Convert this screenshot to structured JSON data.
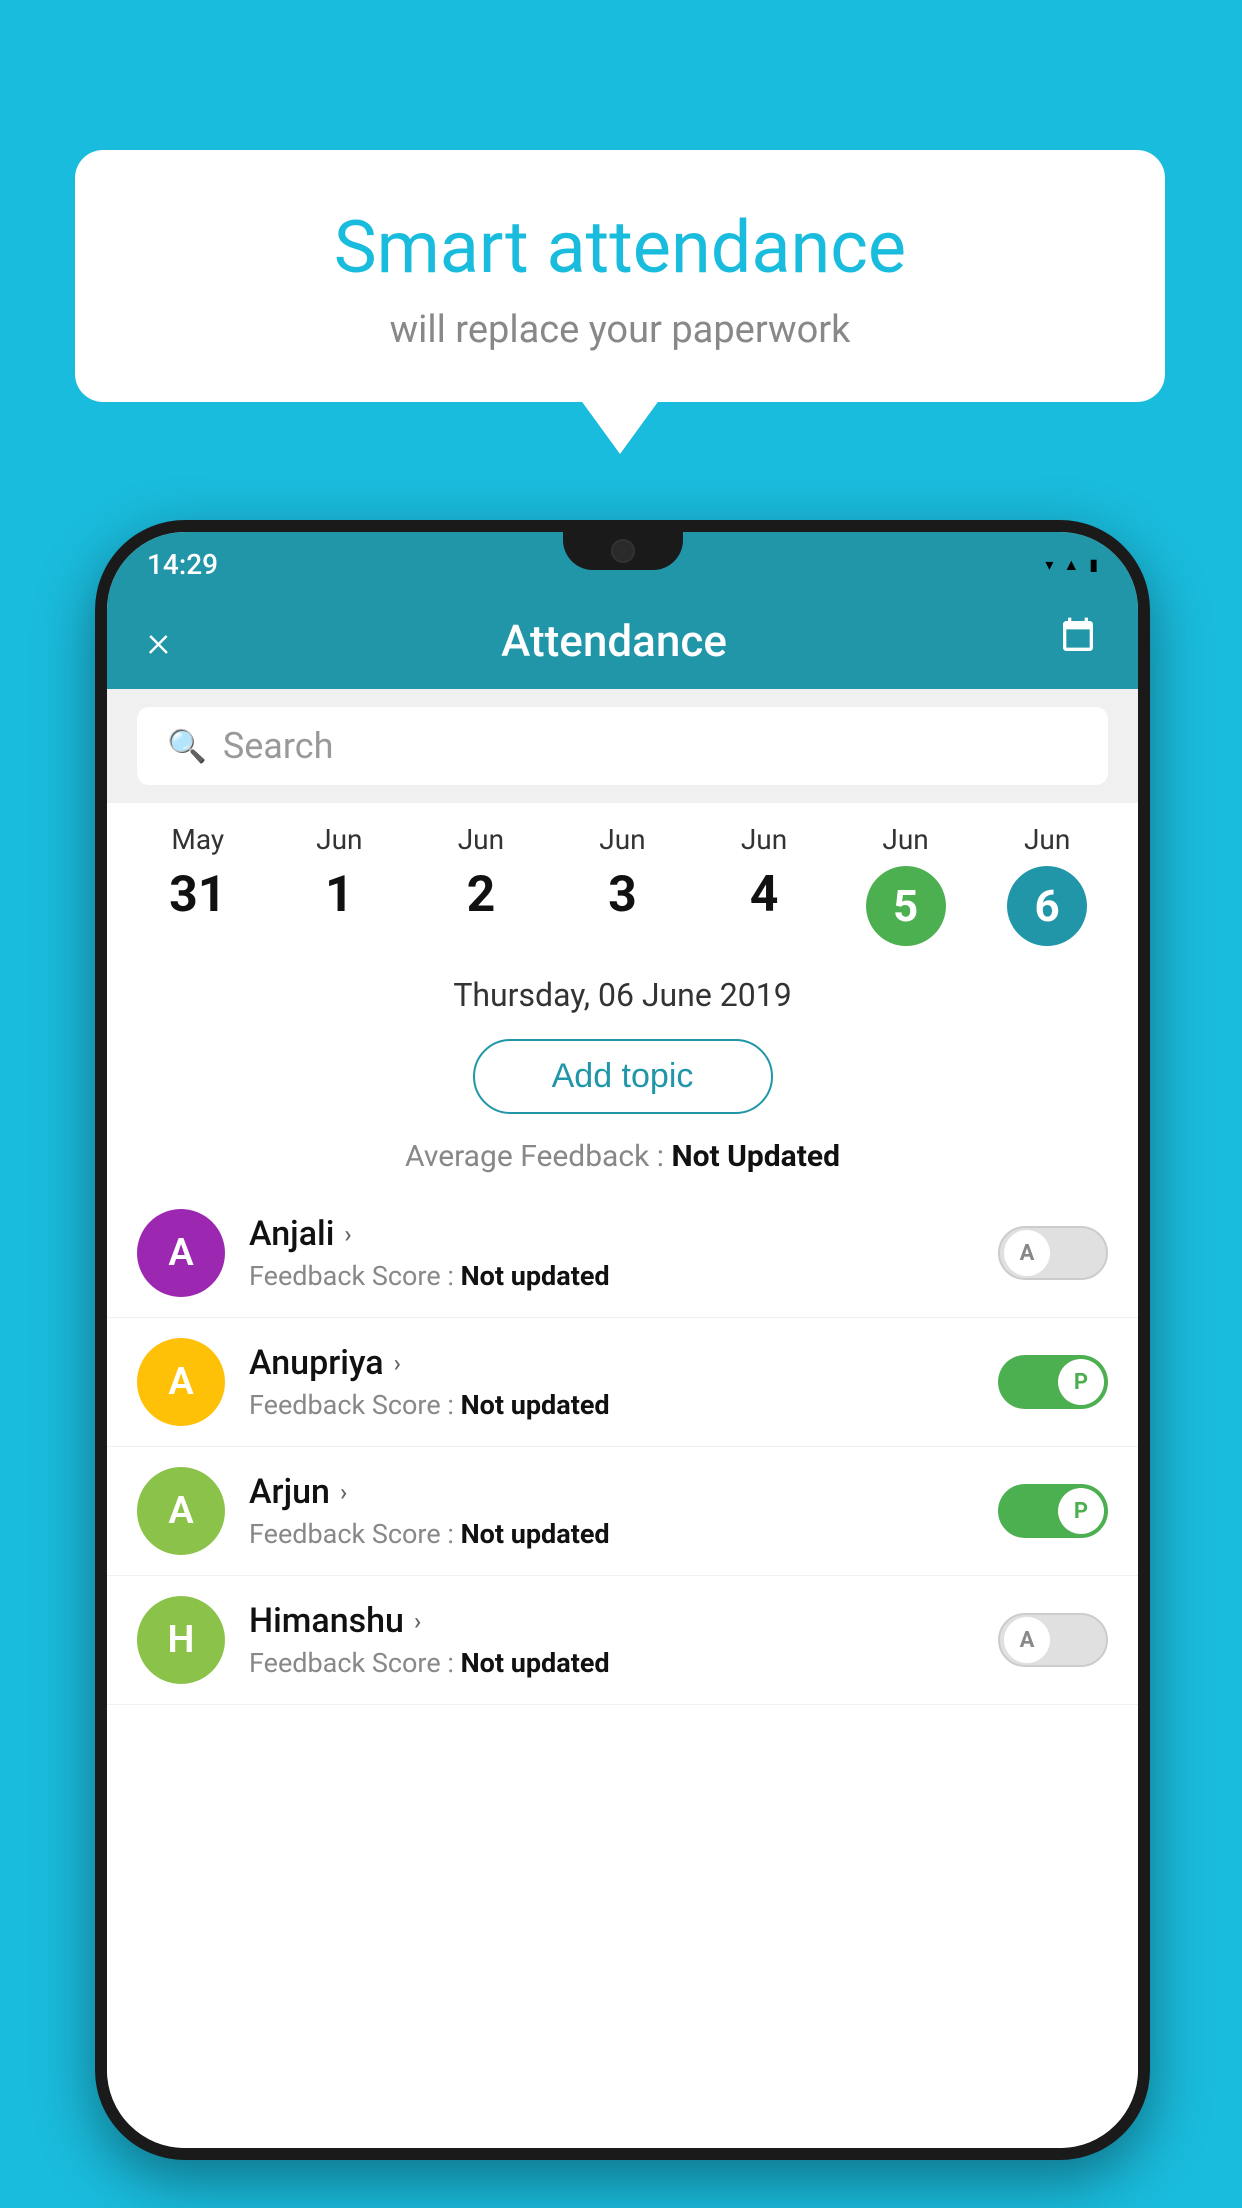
{
  "background_color": "#1ABCDD",
  "speech_bubble": {
    "title": "Smart attendance",
    "subtitle": "will replace your paperwork"
  },
  "status_bar": {
    "time": "14:29",
    "icons": [
      "wifi",
      "signal",
      "battery"
    ]
  },
  "app_bar": {
    "title": "Attendance",
    "close_label": "×",
    "calendar_icon": "📅"
  },
  "search": {
    "placeholder": "Search"
  },
  "dates": [
    {
      "month": "May",
      "day": "31",
      "state": "normal"
    },
    {
      "month": "Jun",
      "day": "1",
      "state": "normal"
    },
    {
      "month": "Jun",
      "day": "2",
      "state": "normal"
    },
    {
      "month": "Jun",
      "day": "3",
      "state": "normal"
    },
    {
      "month": "Jun",
      "day": "4",
      "state": "normal"
    },
    {
      "month": "Jun",
      "day": "5",
      "state": "today"
    },
    {
      "month": "Jun",
      "day": "6",
      "state": "selected"
    }
  ],
  "selected_date_label": "Thursday, 06 June 2019",
  "add_topic_label": "Add topic",
  "average_feedback_label": "Average Feedback : ",
  "average_feedback_value": "Not Updated",
  "students": [
    {
      "name": "Anjali",
      "initial": "A",
      "avatar_color": "purple",
      "feedback": "Feedback Score : ",
      "feedback_value": "Not updated",
      "toggle": "off",
      "toggle_label": "A"
    },
    {
      "name": "Anupriya",
      "initial": "A",
      "avatar_color": "yellow",
      "feedback": "Feedback Score : ",
      "feedback_value": "Not updated",
      "toggle": "on",
      "toggle_label": "P"
    },
    {
      "name": "Arjun",
      "initial": "A",
      "avatar_color": "green",
      "feedback": "Feedback Score : ",
      "feedback_value": "Not updated",
      "toggle": "on",
      "toggle_label": "P"
    },
    {
      "name": "Himanshu",
      "initial": "H",
      "avatar_color": "light-green",
      "feedback": "Feedback Score : ",
      "feedback_value": "Not updated",
      "toggle": "off",
      "toggle_label": "A"
    }
  ]
}
